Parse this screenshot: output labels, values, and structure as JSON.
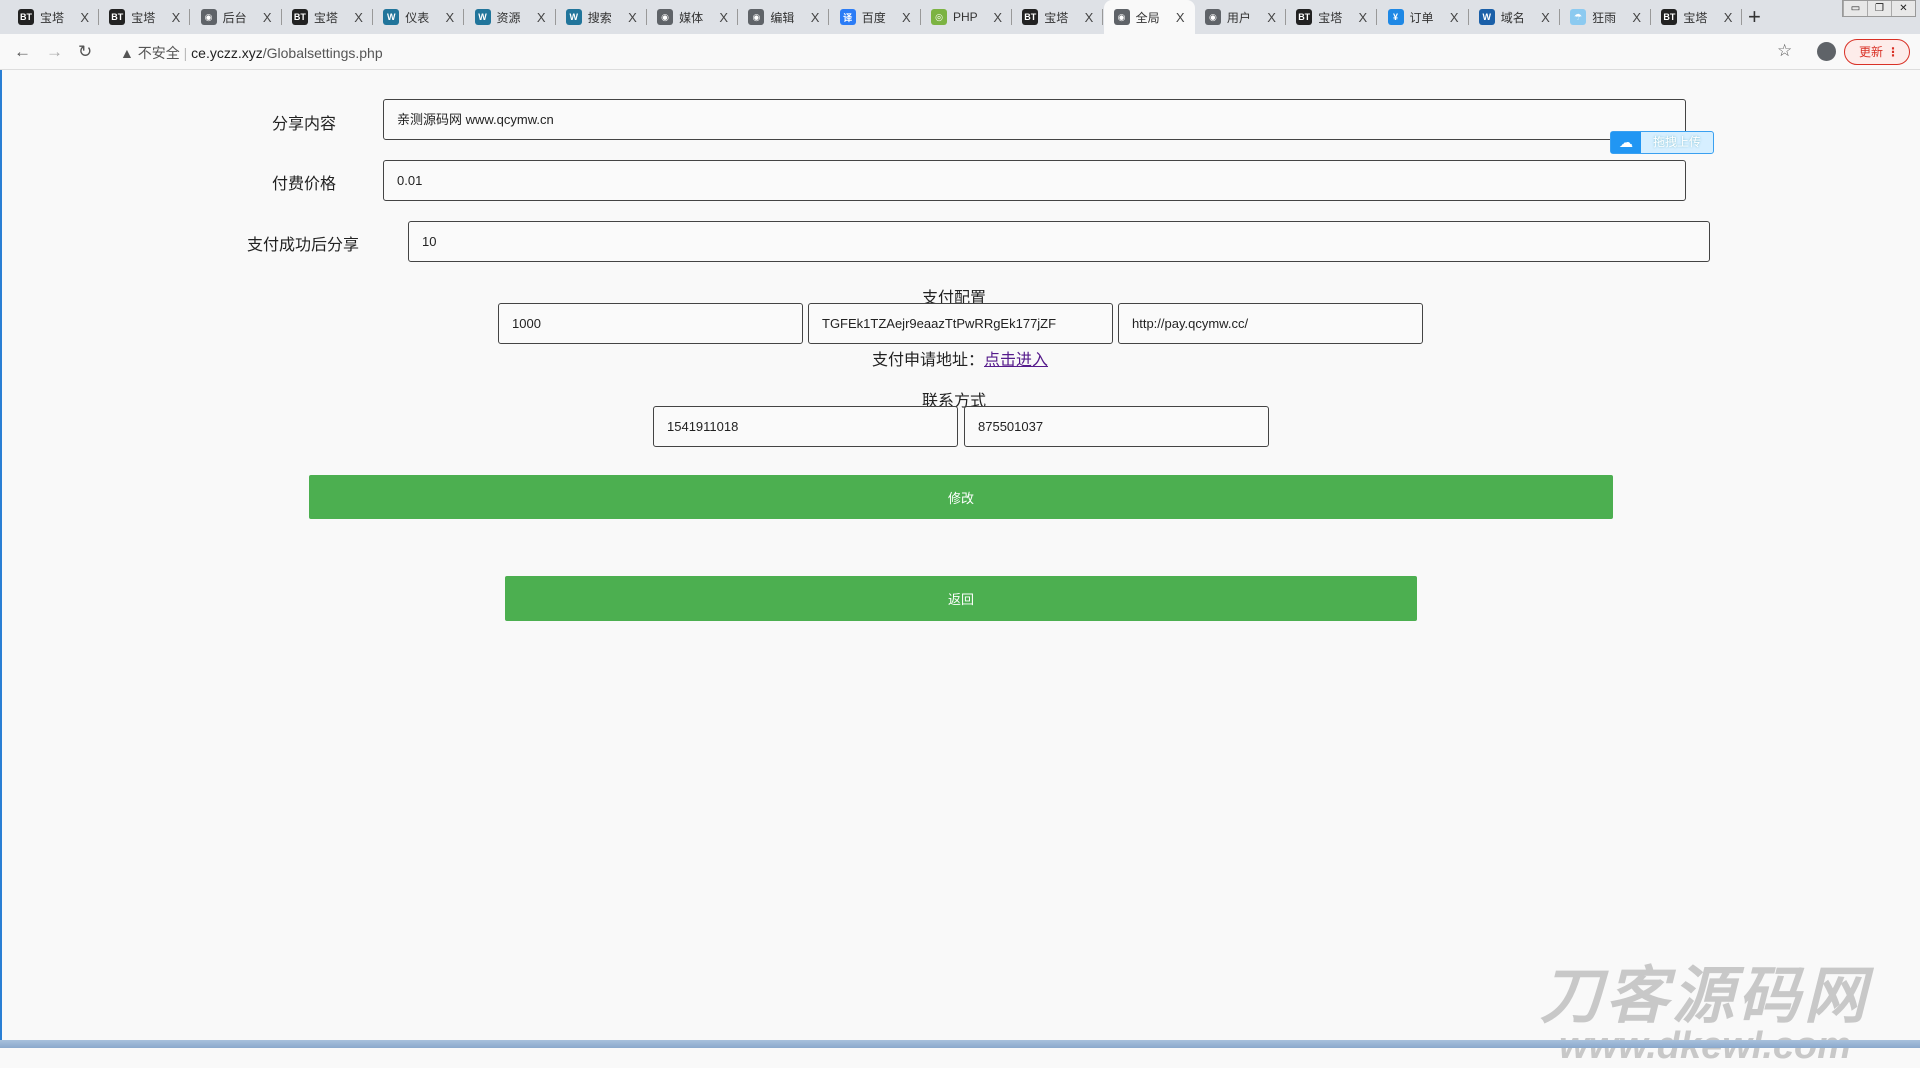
{
  "browser": {
    "tabs": [
      {
        "label": "宝塔",
        "icon": "bt-icon"
      },
      {
        "label": "宝塔",
        "icon": "bt-icon"
      },
      {
        "label": "后台",
        "icon": "globe-icon"
      },
      {
        "label": "宝塔",
        "icon": "bt-icon"
      },
      {
        "label": "仪表",
        "icon": "wordpress-icon"
      },
      {
        "label": "资源",
        "icon": "wordpress-icon"
      },
      {
        "label": "搜索",
        "icon": "wordpress-icon"
      },
      {
        "label": "媒体",
        "icon": "globe-icon"
      },
      {
        "label": "编辑",
        "icon": "globe-icon"
      },
      {
        "label": "百度",
        "icon": "translate-icon"
      },
      {
        "label": "PHP",
        "icon": "php-icon"
      },
      {
        "label": "宝塔",
        "icon": "bt-icon"
      },
      {
        "label": "全局",
        "icon": "globe-icon",
        "active": true
      },
      {
        "label": "用户",
        "icon": "globe-icon"
      },
      {
        "label": "宝塔",
        "icon": "bt-icon"
      },
      {
        "label": "订单",
        "icon": "order-icon"
      },
      {
        "label": "域名",
        "icon": "domain-icon"
      },
      {
        "label": "狂雨",
        "icon": "rain-icon"
      },
      {
        "label": "宝塔",
        "icon": "bt-icon"
      }
    ],
    "close_glyph": "X",
    "new_tab": "+",
    "security": "不安全",
    "url_host": "ce.yczz.xyz",
    "url_path": "/Globalsettings.php",
    "update_label": "更新"
  },
  "form": {
    "share_content_label": "分享内容",
    "share_content": "亲测源码网 www.qcymw.cn",
    "price_label": "付费价格",
    "price": "0.01",
    "after_pay_label": "支付成功后分享",
    "after_pay": "10",
    "pay_config_label": "支付配置",
    "pay_id": "1000",
    "pay_key": "TGFEk1TZAejr9eaazTtPwRRgEk177jZF",
    "pay_url": "http://pay.qcymw.cc/",
    "apply_label": "支付申请地址：",
    "apply_link": "点击进入",
    "contact_label": "联系方式",
    "contact_1": "1541911018",
    "contact_2": "875501037",
    "submit": "修改",
    "back": "返回"
  },
  "upload_widget": "拖拽上传",
  "watermark": {
    "line1": "刀客源码网",
    "line2": "www.dkewl.com"
  },
  "colors": {
    "button": "#4caf50",
    "update": "#d93025"
  }
}
